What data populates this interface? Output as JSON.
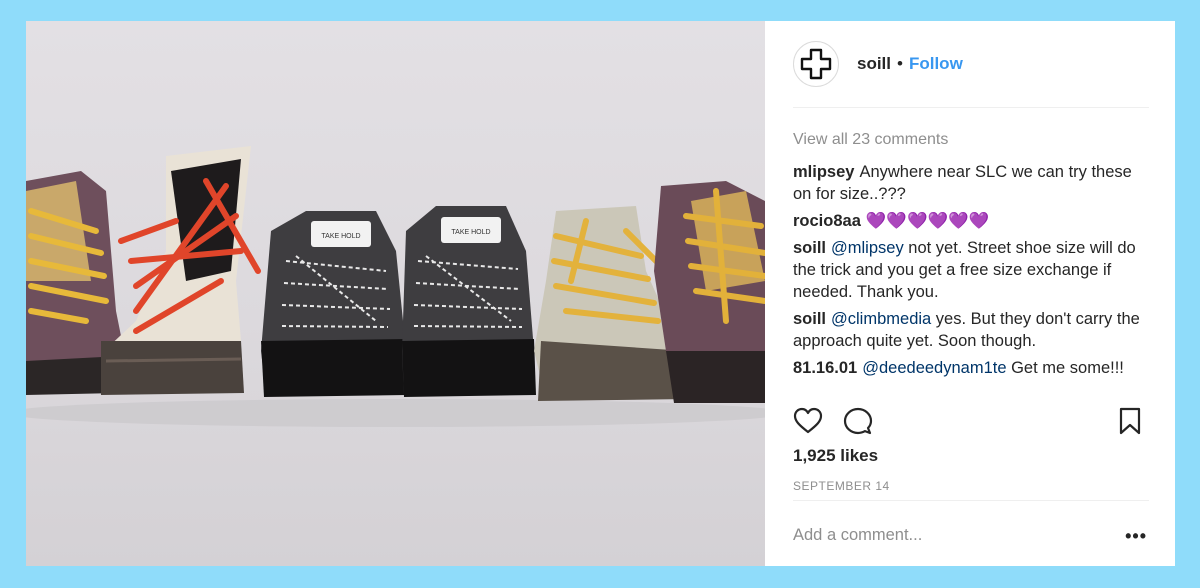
{
  "post": {
    "username": "soill",
    "separator": "•",
    "follow_label": "Follow",
    "view_all": "View all 23 comments",
    "comments": [
      {
        "user": "mlipsey",
        "mention": "",
        "text": "Anywhere near SLC we can try these on for size..???"
      },
      {
        "user": "rocio8aa",
        "mention": "",
        "text": "💜💜💜💜💜💜"
      },
      {
        "user": "soill",
        "mention": "@mlipsey",
        "text": " not yet. Street shoe size will do the trick and you get a free size exchange if needed. Thank you."
      },
      {
        "user": "soill",
        "mention": "@climbmedia",
        "text": " yes. But they don't carry the approach quite yet. Soon though."
      },
      {
        "user": "81.16.01",
        "mention": "@deedeedynam1te",
        "text": " Get me some!!!"
      }
    ],
    "likes": "1,925 likes",
    "date": "SEPTEMBER 14",
    "add_comment_placeholder": "Add a comment...",
    "more": "•••"
  },
  "photo": {
    "shoe_label": "TAKE HOLD"
  },
  "icons": {
    "avatar": "plus-cross-logo-icon",
    "like": "heart-icon",
    "comment": "comment-bubble-icon",
    "save": "bookmark-icon"
  },
  "colors": {
    "background": "#8fdcfa",
    "link": "#3897f0",
    "mention": "#003569",
    "muted": "#8e8e8e"
  }
}
